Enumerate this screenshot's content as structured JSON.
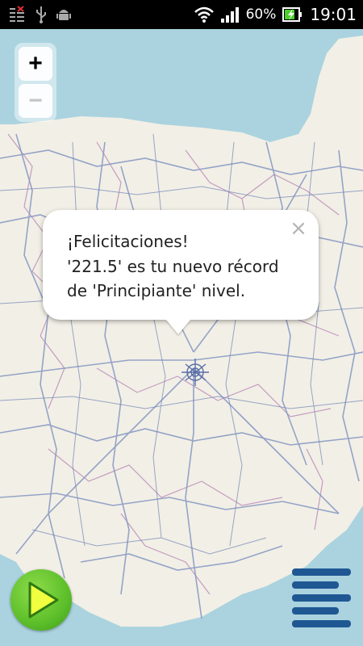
{
  "status_bar": {
    "battery_percent": "60%",
    "time": "19:01",
    "icons": [
      "sim-icon",
      "usb-icon",
      "android-debug-icon",
      "wifi-icon",
      "signal-icon",
      "battery-charging-icon"
    ]
  },
  "map": {
    "zoom_in_label": "+",
    "zoom_out_label": "−",
    "colors": {
      "land": "#f2efe6",
      "sea": "#aad3df",
      "roads": "#8a9bc4",
      "boundaries": "#b07ab0"
    }
  },
  "popup": {
    "lines": [
      "¡Felicitaciones!",
      "'221.5' es tu nuevo récord",
      "de 'Principiante' nivel."
    ],
    "close_label": "×"
  },
  "controls": {
    "play_icon": "play-icon",
    "menu_icon": "menu-icon",
    "play_color": "#5cbf2a",
    "menu_color": "#1f5793"
  }
}
